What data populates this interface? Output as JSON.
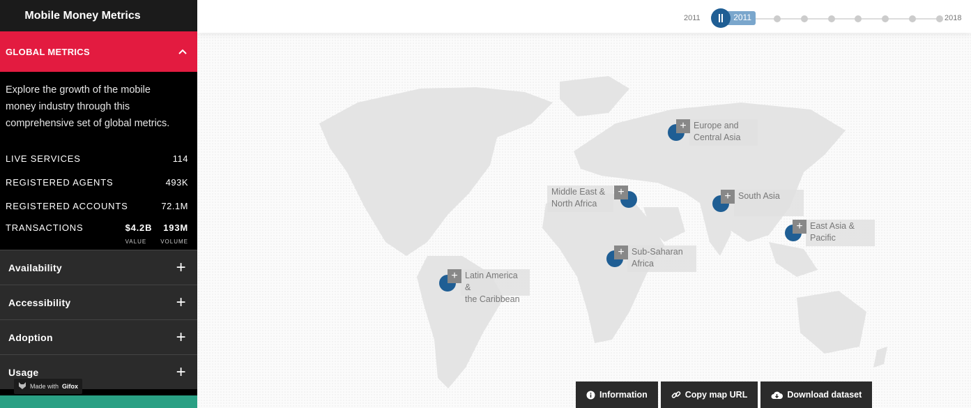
{
  "sidebar": {
    "title": "Mobile Money Metrics",
    "global_header": "GLOBAL METRICS",
    "intro": "Explore the growth of the mobile money industry through this comprehensive set of global metrics.",
    "metrics": [
      {
        "label": "LIVE SERVICES",
        "value": "114"
      },
      {
        "label": "REGISTERED AGENTS",
        "value": "493K"
      },
      {
        "label": "REGISTERED ACCOUNTS",
        "value": "72.1M"
      }
    ],
    "transactions": {
      "label": "TRANSACTIONS",
      "value": "$4.2B",
      "volume": "193M",
      "value_caption": "VALUE",
      "volume_caption": "VOLUME"
    },
    "sections": [
      "Availability",
      "Accessibility",
      "Adoption",
      "Usage"
    ],
    "gifox": {
      "prefix": "Made with",
      "brand": "Gifox"
    }
  },
  "timeline": {
    "start_label": "2011",
    "end_label": "2018",
    "current": "2011",
    "years_total": 8,
    "selected_index": 0
  },
  "regions": [
    {
      "line1": "Europe and",
      "line2": "Central Asia"
    },
    {
      "line1": "Middle East &",
      "line2": "North Africa"
    },
    {
      "line1": "South Asia",
      "line2": ""
    },
    {
      "line1": "East Asia &",
      "line2": "Pacific"
    },
    {
      "line1": "Sub-Saharan",
      "line2": "Africa"
    },
    {
      "line1": "Latin America &",
      "line2": "the Caribbean"
    }
  ],
  "buttons": {
    "information": "Information",
    "copy_url": "Copy map URL",
    "download": "Download dataset"
  },
  "colors": {
    "accent_red": "#e31b40",
    "region_blue": "#1f5e94",
    "bottom_green": "#2aa084"
  }
}
